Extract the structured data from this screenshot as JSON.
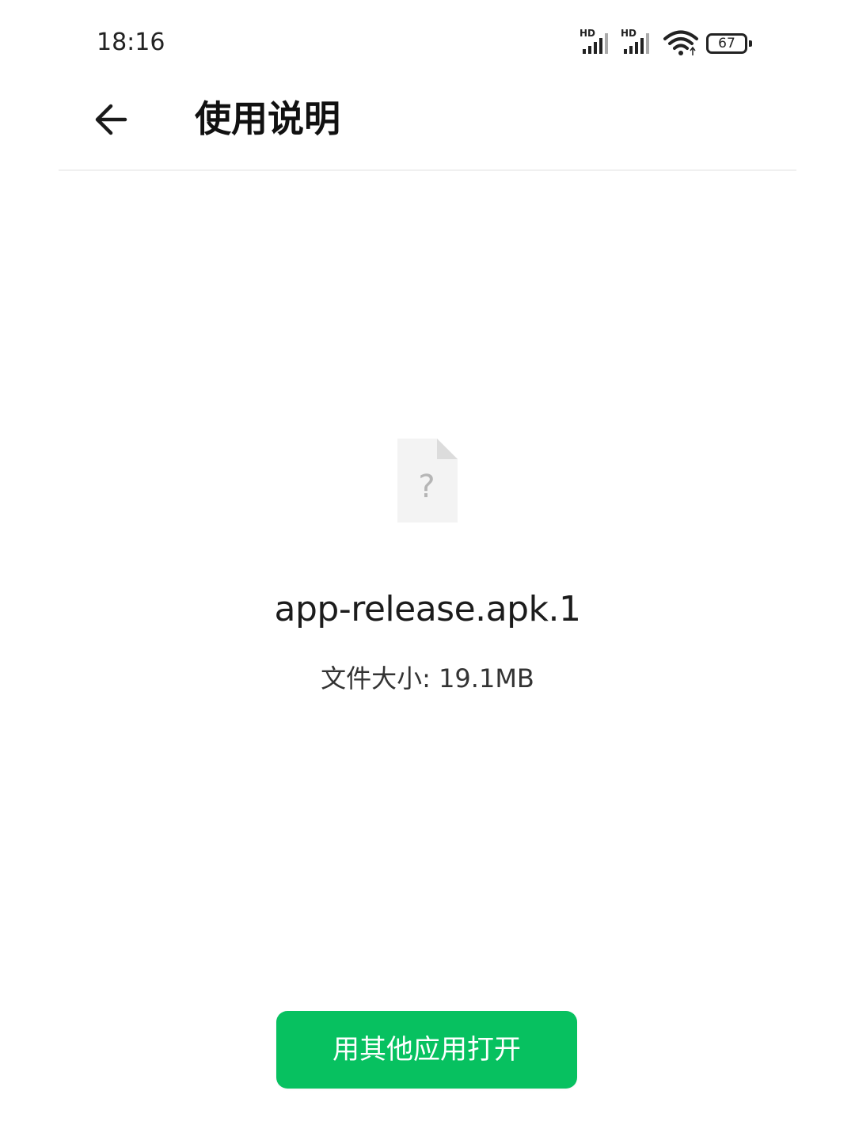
{
  "status_bar": {
    "time": "18:16",
    "sim1_label": "HD",
    "sim2_label": "HD",
    "battery_level": "67"
  },
  "header": {
    "title": "使用说明"
  },
  "file": {
    "icon_glyph": "?",
    "name": "app-release.apk.1",
    "size": "文件大小: 19.1MB"
  },
  "actions": {
    "open_with_other_app": "用其他应用打开"
  },
  "colors": {
    "accent": "#07c160",
    "background": "#ffffff"
  }
}
